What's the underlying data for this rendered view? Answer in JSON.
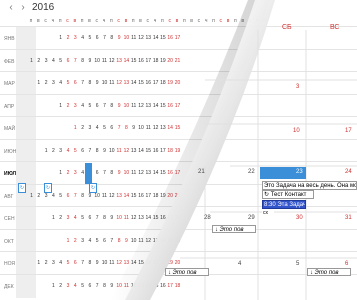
{
  "header": {
    "year": "2016",
    "prev_icon": "chevron-left-icon",
    "next_icon": "chevron-right-icon"
  },
  "weekday_labels": [
    "п",
    "в",
    "с",
    "ч",
    "п",
    "с",
    "в",
    "п",
    "в",
    "с",
    "ч",
    "п",
    "с",
    "в",
    "п",
    "в",
    "с",
    "ч",
    "п",
    "с",
    "в",
    "п",
    "в",
    "с",
    "ч",
    "п",
    "с",
    "в",
    "п",
    "в",
    "с",
    "ч",
    "п"
  ],
  "months": [
    {
      "label": "ЯНВ",
      "days": [
        "",
        "",
        "",
        "",
        "1",
        "2",
        "3",
        "4",
        "5",
        "6",
        "7",
        "8",
        "9",
        "10",
        "11",
        "12",
        "13",
        "14",
        "15",
        "16",
        "17"
      ]
    },
    {
      "label": "ФЕВ",
      "days": [
        "1",
        "2",
        "3",
        "4",
        "5",
        "6",
        "7",
        "8",
        "9",
        "10",
        "11",
        "12",
        "13",
        "14",
        "15",
        "16",
        "17",
        "18",
        "19",
        "20",
        "21"
      ]
    },
    {
      "label": "МАР",
      "days": [
        "",
        "1",
        "2",
        "3",
        "4",
        "5",
        "6",
        "7",
        "8",
        "9",
        "10",
        "11",
        "12",
        "13",
        "14",
        "15",
        "16",
        "17",
        "18",
        "19",
        "20"
      ]
    },
    {
      "label": "АПР",
      "days": [
        "",
        "",
        "",
        "",
        "1",
        "2",
        "3",
        "4",
        "5",
        "6",
        "7",
        "8",
        "9",
        "10",
        "11",
        "12",
        "13",
        "14",
        "15",
        "16",
        "17"
      ]
    },
    {
      "label": "МАЙ",
      "days": [
        "",
        "",
        "",
        "",
        "",
        "",
        "1",
        "2",
        "3",
        "4",
        "5",
        "6",
        "7",
        "8",
        "9",
        "10",
        "11",
        "12",
        "13",
        "14",
        "15"
      ]
    },
    {
      "label": "ИЮН",
      "days": [
        "",
        "",
        "1",
        "2",
        "3",
        "4",
        "5",
        "6",
        "7",
        "8",
        "9",
        "10",
        "11",
        "12",
        "13",
        "14",
        "15",
        "16",
        "17",
        "18",
        "19"
      ]
    },
    {
      "label": "ИЮЛ",
      "days": [
        "",
        "",
        "",
        "",
        "1",
        "2",
        "3",
        "4",
        "5",
        "6",
        "7",
        "8",
        "9",
        "10",
        "11",
        "12",
        "13",
        "14",
        "15",
        "16",
        "17"
      ]
    },
    {
      "label": "АВГ",
      "days": [
        "1",
        "2",
        "3",
        "4",
        "5",
        "6",
        "7",
        "8",
        "9",
        "10",
        "11",
        "12",
        "13",
        "14",
        "15",
        "16",
        "17",
        "18",
        "19",
        "20",
        "21"
      ]
    },
    {
      "label": "СЕН",
      "days": [
        "",
        "",
        "",
        "1",
        "2",
        "3",
        "4",
        "5",
        "6",
        "7",
        "8",
        "9",
        "10",
        "11",
        "12",
        "13",
        "14",
        "15",
        "16",
        "17",
        "18"
      ]
    },
    {
      "label": "ОКТ",
      "days": [
        "",
        "",
        "",
        "",
        "",
        "1",
        "2",
        "3",
        "4",
        "5",
        "6",
        "7",
        "8",
        "9",
        "10",
        "11",
        "12",
        "13",
        "14",
        "15",
        "16"
      ]
    },
    {
      "label": "НОЯ",
      "days": [
        "",
        "1",
        "2",
        "3",
        "4",
        "5",
        "6",
        "7",
        "8",
        "9",
        "10",
        "11",
        "12",
        "13",
        "14",
        "15",
        "16",
        "17",
        "18",
        "19",
        "20"
      ]
    },
    {
      "label": "ДЕК",
      "days": [
        "",
        "",
        "",
        "1",
        "2",
        "3",
        "4",
        "5",
        "6",
        "7",
        "8",
        "9",
        "10",
        "11",
        "12",
        "13",
        "14",
        "15",
        "16",
        "17",
        "18"
      ]
    }
  ],
  "current_month": "ИЮЛ",
  "month_view": {
    "dow": [
      "СБ",
      "ВС"
    ],
    "dates": [
      "3",
      "10",
      "17",
      "21",
      "22",
      "23",
      "24",
      "28",
      "29",
      "30",
      "31",
      "4",
      "5",
      "6"
    ],
    "events": {
      "allday": "Это Задача на весь день. Она мо",
      "contact": "Тест Контакт",
      "task_time": "8:30 Эта Задача",
      "task_cont": "сх",
      "bottom": "Это пов"
    }
  },
  "colors": {
    "accent": "#3a8fd8",
    "weekend": "#d03030",
    "selected_event": "#3355cc"
  }
}
